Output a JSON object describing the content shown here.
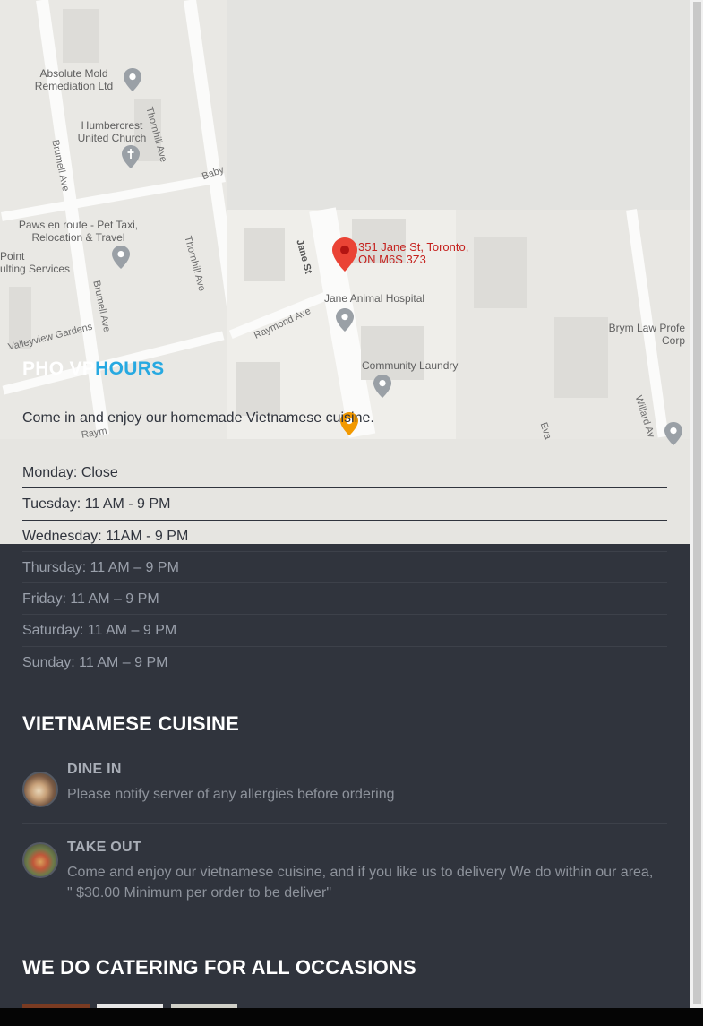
{
  "map": {
    "address": [
      "351 Jane St, Toronto,",
      "ON M6S 3Z3"
    ],
    "places": {
      "absolute_mold": [
        "Absolute Mold",
        "Remediation Ltd"
      ],
      "humbercrest": [
        "Humbercrest",
        "United Church"
      ],
      "paws": [
        "Paws en route - Pet Taxi,",
        "Relocation & Travel"
      ],
      "point": [
        "Point",
        "ulting Services"
      ],
      "jane_animal": "Jane Animal Hospital",
      "community_laundry": "Community Laundry",
      "brym": [
        "Brym Law Profe",
        "Corp"
      ]
    },
    "streets": {
      "thornhill_1": "Thornhill Ave",
      "thornhill_2": "Thornhill Ave",
      "brumell_1": "Brumell Ave",
      "brumell_2": "Brumell Ave",
      "baby": "Baby",
      "jane": "Jane St",
      "raymond": "Raymond Ave",
      "valleyview": "Valleyview Gardens",
      "raym": "Raym",
      "willard": "Willard Av",
      "eva": "Eva"
    }
  },
  "hours": {
    "title_white": "PHO VP",
    "title_blue": "HOURS",
    "intro": "Come in and enjoy our homemade Vietnamese cuisine.",
    "days": [
      "Monday: Close",
      "Tuesday: 11 AM - 9 PM",
      "Wednesday: 11AM - 9 PM",
      "Thursday: 11 AM – 9 PM",
      "Friday: 11 AM – 9 PM",
      "Saturday: 11 AM – 9 PM",
      "Sunday: 11 AM – 9 PM"
    ]
  },
  "cuisine": {
    "title": "VIETNAMESE CUISINE",
    "services": [
      {
        "name": "DINE IN",
        "desc": "Please notify server of any allergies before ordering"
      },
      {
        "name": "TAKE OUT",
        "desc": "Come and enjoy our vietnamese cuisine, and if you like us to delivery We do within our area, \" $30.00 Minimum per order to be deliver\""
      }
    ]
  },
  "catering": {
    "title": "WE DO CATERING FOR ALL OCCASIONS"
  },
  "colors": {
    "accent": "#27a9e1",
    "dark_bg": "#30343d",
    "map_bg": "#e6e5e1",
    "pin_red": "#ea4335"
  }
}
